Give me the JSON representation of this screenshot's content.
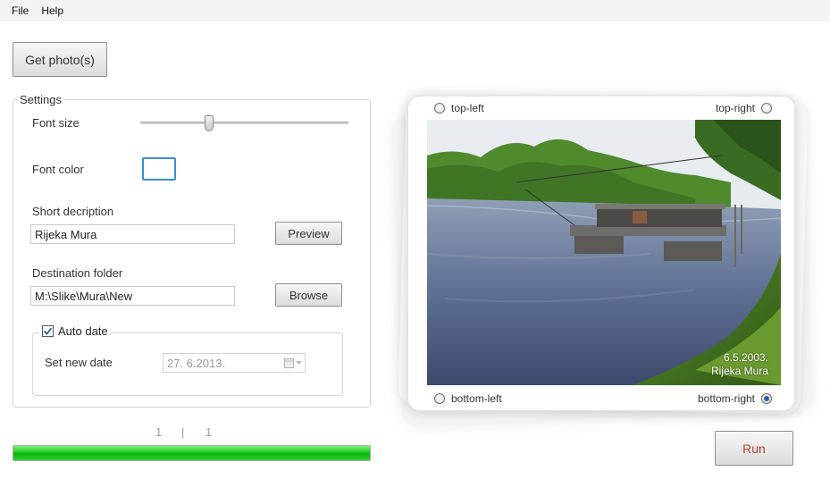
{
  "menu": {
    "file": "File",
    "help": "Help"
  },
  "toolbar": {
    "get_photos": "Get photo(s)"
  },
  "settings": {
    "legend": "Settings",
    "font_size_label": "Font size",
    "font_size_slider_fraction": 0.33,
    "font_color_label": "Font color",
    "font_color_value": "#ffffff",
    "short_description_label": "Short decription",
    "short_description_value": "Rijeka Mura",
    "preview_button": "Preview",
    "destination_folder_label": "Destination folder",
    "destination_folder_value": "M:\\Slike\\Mura\\New",
    "browse_button": "Browse",
    "auto_date": {
      "label": "Auto date",
      "checked": true,
      "set_new_date_label": "Set new date",
      "date_value": "27.  6.2013."
    }
  },
  "counter": {
    "current": "1",
    "separator": "|",
    "total": "1"
  },
  "progress": {
    "fraction": 1.0,
    "color": "#22c822"
  },
  "preview": {
    "top_left": "top-left",
    "top_right": "top-right",
    "bottom_left": "bottom-left",
    "bottom_right": "bottom-right",
    "selected_position": "bottom-right",
    "watermark_date": "6.5.2003.",
    "watermark_text": "Rijeka Mura"
  },
  "actions": {
    "run": "Run"
  },
  "colors": {
    "accent": "#3b8ed3",
    "run_text": "#b34040"
  }
}
